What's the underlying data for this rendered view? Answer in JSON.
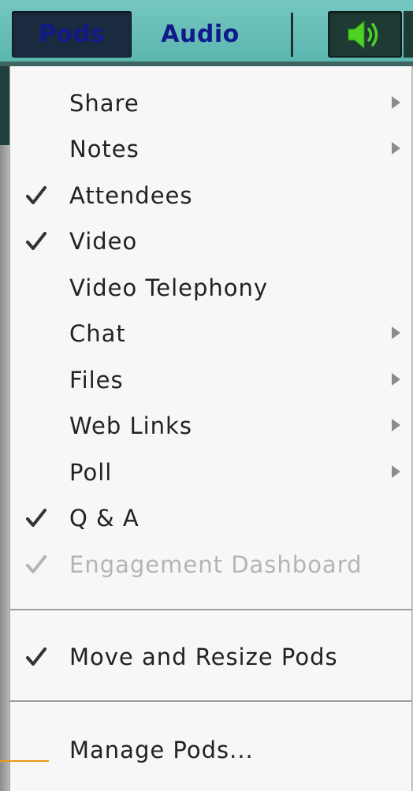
{
  "menubar": {
    "pods_label": "Pods",
    "audio_label": "Audio",
    "speaker_icon": "speaker-icon",
    "speaker_color": "#4fd323"
  },
  "dropdown": {
    "items": [
      {
        "label": "Share",
        "checked": false,
        "submenu": true,
        "disabled": false
      },
      {
        "label": "Notes",
        "checked": false,
        "submenu": true,
        "disabled": false
      },
      {
        "label": "Attendees",
        "checked": true,
        "submenu": false,
        "disabled": false
      },
      {
        "label": "Video",
        "checked": true,
        "submenu": false,
        "disabled": false
      },
      {
        "label": "Video Telephony",
        "checked": false,
        "submenu": false,
        "disabled": false
      },
      {
        "label": "Chat",
        "checked": false,
        "submenu": true,
        "disabled": false
      },
      {
        "label": "Files",
        "checked": false,
        "submenu": true,
        "disabled": false
      },
      {
        "label": "Web Links",
        "checked": false,
        "submenu": true,
        "disabled": false
      },
      {
        "label": "Poll",
        "checked": false,
        "submenu": true,
        "disabled": false
      },
      {
        "label": "Q & A",
        "checked": true,
        "submenu": false,
        "disabled": false
      },
      {
        "label": "Engagement Dashboard",
        "checked": true,
        "submenu": false,
        "disabled": true
      }
    ],
    "move_resize": {
      "label": "Move and Resize Pods",
      "checked": true
    },
    "manage": {
      "label": "Manage Pods..."
    }
  }
}
